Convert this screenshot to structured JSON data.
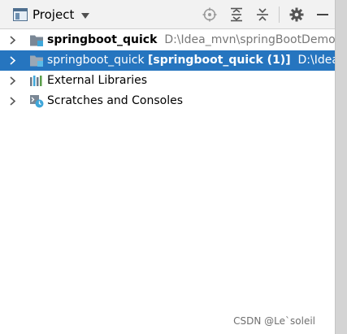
{
  "header": {
    "title": "Project"
  },
  "tree": {
    "rows": [
      {
        "name": "springboot_quick",
        "path": "D:\\Idea_mvn\\springBootDemo"
      },
      {
        "name": "springboot_quick",
        "module": "[springboot_quick (1)]",
        "path": "D:\\Idea"
      },
      {
        "name": "External Libraries"
      },
      {
        "name": "Scratches and Consoles"
      }
    ]
  },
  "watermark": "CSDN @Le`soleil",
  "colors": {
    "selection": "#2675bf",
    "header_bg": "#f2f2f2",
    "folder": "#7a8795",
    "module_badge": "#3fa6d9"
  },
  "icons": {
    "header": [
      "project-view-icon",
      "locate-icon",
      "expand-all-icon",
      "collapse-all-icon",
      "settings-gear-icon",
      "hide-minus-icon"
    ],
    "tree": [
      "module-folder-icon",
      "external-libraries-icon",
      "scratches-icon"
    ]
  }
}
